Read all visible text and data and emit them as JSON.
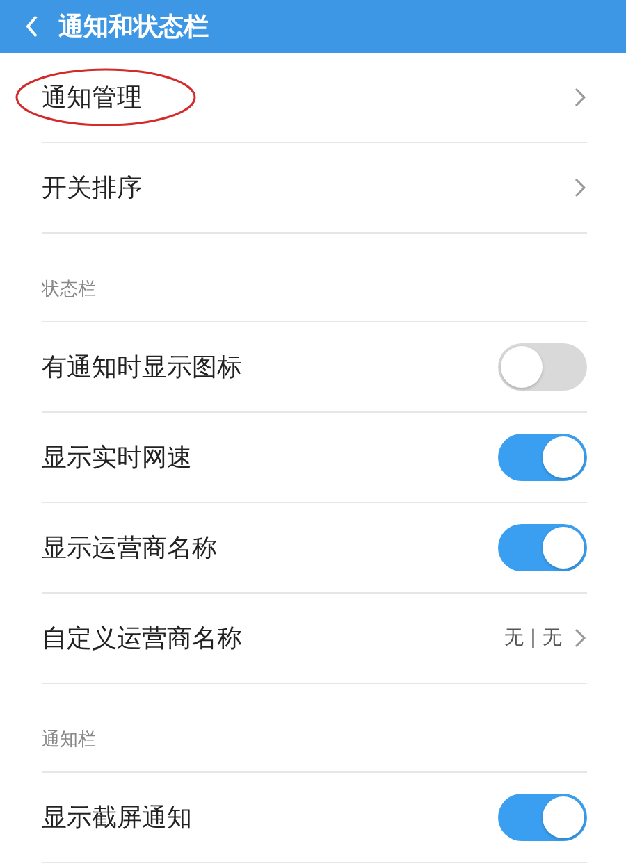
{
  "header": {
    "title": "通知和状态栏"
  },
  "sections": [
    {
      "rows": [
        {
          "kind": "link",
          "label": "通知管理",
          "circled": true
        },
        {
          "kind": "link",
          "label": "开关排序",
          "circled": false
        }
      ]
    },
    {
      "title": "状态栏",
      "rows": [
        {
          "kind": "toggle",
          "label": "有通知时显示图标",
          "on": false
        },
        {
          "kind": "toggle",
          "label": "显示实时网速",
          "on": true
        },
        {
          "kind": "toggle",
          "label": "显示运营商名称",
          "on": true
        },
        {
          "kind": "link",
          "label": "自定义运营商名称",
          "value": "无 | 无",
          "circled": false
        }
      ]
    },
    {
      "title": "通知栏",
      "rows": [
        {
          "kind": "toggle",
          "label": "显示截屏通知",
          "on": true
        }
      ]
    }
  ]
}
